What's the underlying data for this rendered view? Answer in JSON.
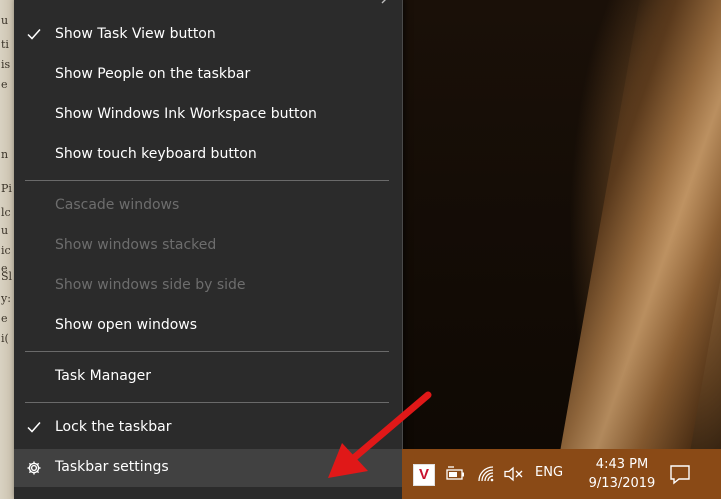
{
  "context_menu": {
    "items": [
      {
        "label": "Show Task View button",
        "checked": true,
        "disabled": false
      },
      {
        "label": "Show People on the taskbar",
        "checked": false,
        "disabled": false
      },
      {
        "label": "Show Windows Ink Workspace button",
        "checked": false,
        "disabled": false
      },
      {
        "label": "Show touch keyboard button",
        "checked": false,
        "disabled": false
      },
      {
        "label": "Cascade windows",
        "checked": false,
        "disabled": true
      },
      {
        "label": "Show windows stacked",
        "checked": false,
        "disabled": true
      },
      {
        "label": "Show windows side by side",
        "checked": false,
        "disabled": true
      },
      {
        "label": "Show open windows",
        "checked": false,
        "disabled": false
      },
      {
        "label": "Task Manager",
        "checked": false,
        "disabled": false
      },
      {
        "label": "Lock the taskbar",
        "checked": true,
        "disabled": false
      },
      {
        "label": "Taskbar settings",
        "checked": false,
        "disabled": false
      }
    ]
  },
  "taskbar": {
    "language": "ENG",
    "time": "4:43 PM",
    "date": "9/13/2019",
    "app_badge": "V"
  },
  "book_letters": [
    "u",
    "ti",
    "is",
    "e",
    "n",
    "Pi",
    "lc",
    "u",
    "ic",
    "e",
    "Sl",
    "y:",
    "e",
    "i("
  ],
  "colors": {
    "menu_bg": "#2b2b2b",
    "taskbar_bg": "#8a4a16",
    "annotation_arrow": "#e01818"
  }
}
